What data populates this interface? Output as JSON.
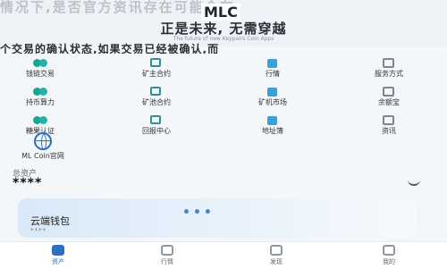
{
  "banner": {
    "ghost_line": "情况下,是否官方资讯存在可能会有",
    "title_left": "",
    "logo": "MLC",
    "subtitle": "正是未来, 无需穿越",
    "english": "The future of new Keypairs Coin Apps",
    "ghost_line2": "个交易的确认状态,如果交易已经被确认,而"
  },
  "services": [
    {
      "label": "钱链交易",
      "icon": "coins-icon"
    },
    {
      "label": "矿主合约",
      "icon": "grid-icon"
    },
    {
      "label": "行情",
      "icon": "chart-icon"
    },
    {
      "label": "服务方式",
      "icon": "box-icon"
    },
    {
      "label": "持币算力",
      "icon": "coins-icon"
    },
    {
      "label": "矿池合约",
      "icon": "grid-icon"
    },
    {
      "label": "矿机市场",
      "icon": "chart-icon"
    },
    {
      "label": "余额宝",
      "icon": "box-icon"
    },
    {
      "label": "糖果认证",
      "icon": "coins-icon"
    },
    {
      "label": "回报中心",
      "icon": "grid-icon"
    },
    {
      "label": "地址簿",
      "icon": "chart-icon"
    },
    {
      "label": "资讯",
      "icon": "box-icon"
    }
  ],
  "ml_coin": {
    "label": "ML Coin官网"
  },
  "assets": {
    "label": "总资产",
    "balance": "****"
  },
  "wallet": {
    "name": "云端钱包",
    "sub": "****"
  },
  "tabs": [
    {
      "label": "资产",
      "active": true
    },
    {
      "label": "行情",
      "active": false
    },
    {
      "label": "发现",
      "active": false
    },
    {
      "label": "我的",
      "active": false
    }
  ]
}
